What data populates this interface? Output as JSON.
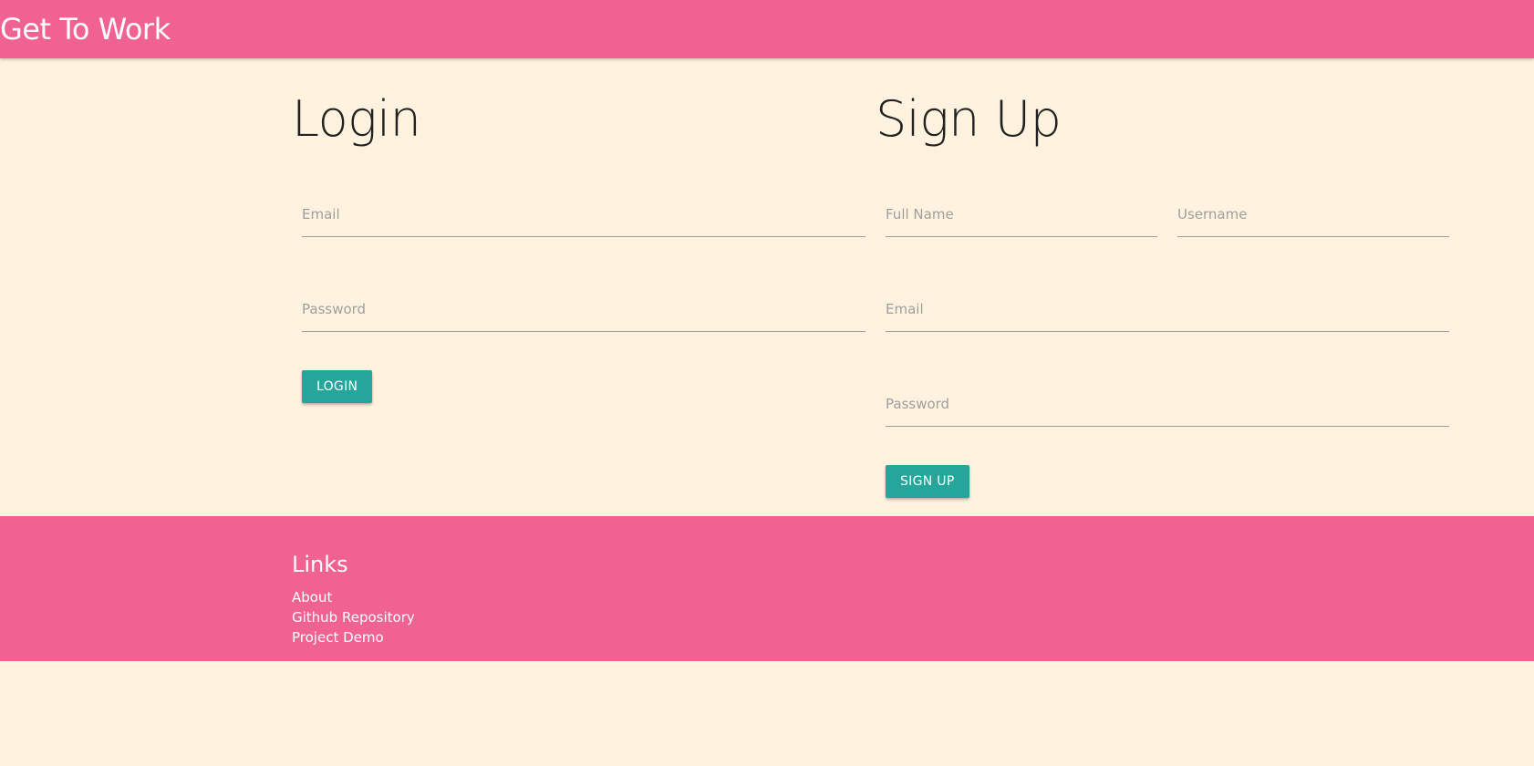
{
  "navbar": {
    "brand": "Get To Work"
  },
  "login": {
    "title": "Login",
    "email_placeholder": "Email",
    "password_placeholder": "Password",
    "submit_label": "LOGIN"
  },
  "signup": {
    "title": "Sign Up",
    "fullname_placeholder": "Full Name",
    "username_placeholder": "Username",
    "email_placeholder": "Email",
    "password_placeholder": "Password",
    "submit_label": "SIGN UP"
  },
  "footer": {
    "title": "Links",
    "links": [
      {
        "label": "About"
      },
      {
        "label": "Github Repository"
      },
      {
        "label": "Project Demo"
      }
    ]
  },
  "colors": {
    "primary": "#f06292",
    "accent": "#26a69a",
    "background": "#fff3e0"
  }
}
